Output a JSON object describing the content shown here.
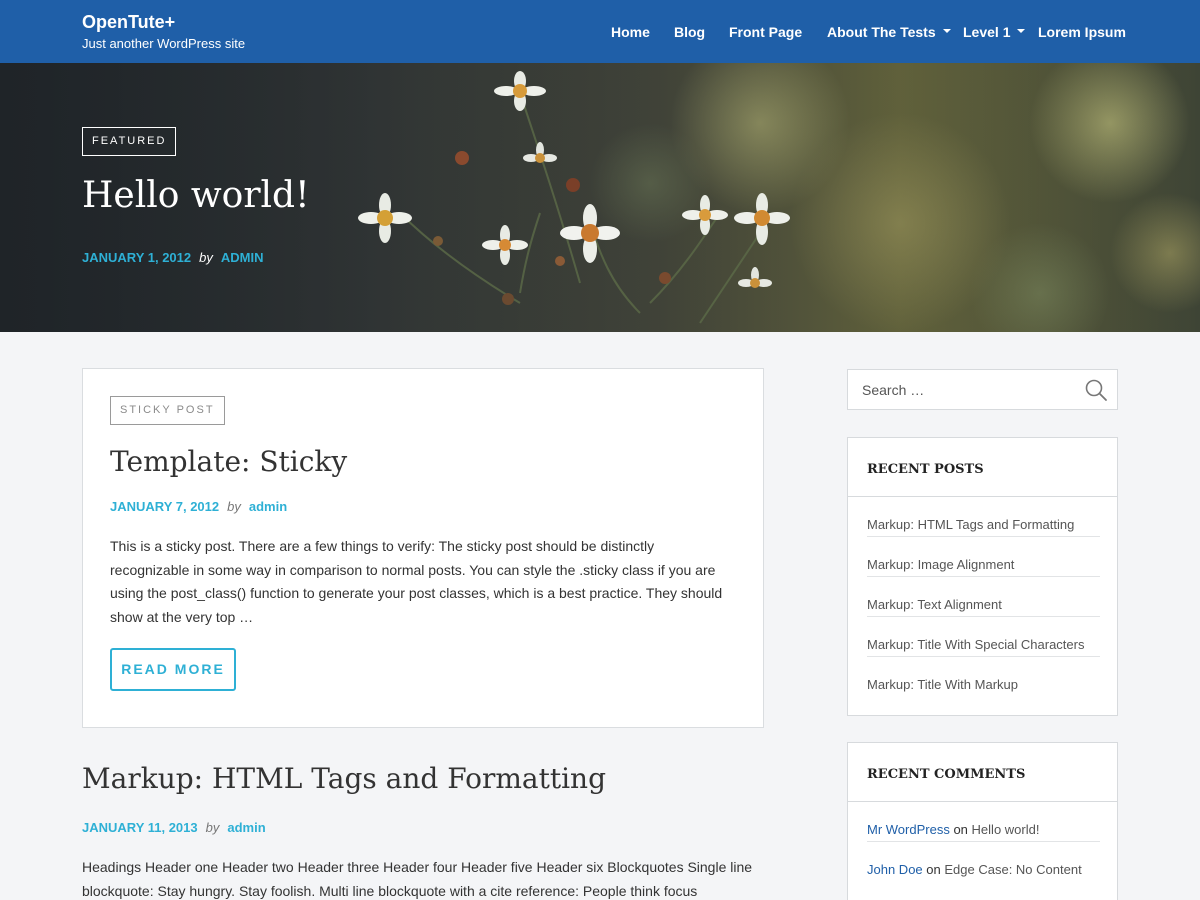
{
  "site": {
    "title": "OpenTute+",
    "tagline": "Just another WordPress site"
  },
  "nav": {
    "items": [
      {
        "label": "Home",
        "has_dropdown": false
      },
      {
        "label": "Blog",
        "has_dropdown": false
      },
      {
        "label": "Front Page",
        "has_dropdown": false
      },
      {
        "label": "About The Tests",
        "has_dropdown": true
      },
      {
        "label": "Level 1",
        "has_dropdown": true
      },
      {
        "label": "Lorem Ipsum",
        "has_dropdown": false
      }
    ]
  },
  "hero": {
    "badge": "FEATURED",
    "title": "Hello world!",
    "date": "JANUARY 1, 2012",
    "by": "by",
    "author": "ADMIN"
  },
  "sticky_post": {
    "badge": "STICKY POST",
    "title": "Template: Sticky",
    "date": "JANUARY 7, 2012",
    "by": "by",
    "author": "admin",
    "excerpt": "This is a sticky post. There are a few things to verify: The sticky post should be distinctly recognizable in some way in comparison to normal posts. You can style the .sticky class if you are using the post_class() function to generate your post classes, which is a best practice. They should show at the very top …",
    "read_more": "READ MORE"
  },
  "post2": {
    "title": "Markup: HTML Tags and Formatting",
    "date": "JANUARY 11, 2013",
    "by": "by",
    "author": "admin",
    "excerpt": "Headings Header one Header two Header three Header four Header five Header six Blockquotes Single line blockquote: Stay hungry. Stay foolish. Multi line blockquote with a cite reference: People think focus"
  },
  "search": {
    "placeholder": "Search …"
  },
  "recent_posts": {
    "title": "RECENT POSTS",
    "items": [
      "Markup: HTML Tags and Formatting",
      "Markup: Image Alignment",
      "Markup: Text Alignment",
      "Markup: Title With Special Characters",
      "Markup: Title With Markup"
    ]
  },
  "recent_comments": {
    "title": "RECENT COMMENTS",
    "items": [
      {
        "author": "Mr WordPress",
        "on": "on",
        "post": "Hello world!"
      },
      {
        "author": "John Doe",
        "on": "on",
        "post": "Edge Case: No Content"
      }
    ]
  },
  "colors": {
    "header_bg": "#1f5fa8",
    "accent": "#2eb0d5",
    "page_bg": "#f4f5f7",
    "card_bg": "#ffffff"
  },
  "icons": {
    "search": "search-icon",
    "dropdown": "chevron-down-icon"
  }
}
